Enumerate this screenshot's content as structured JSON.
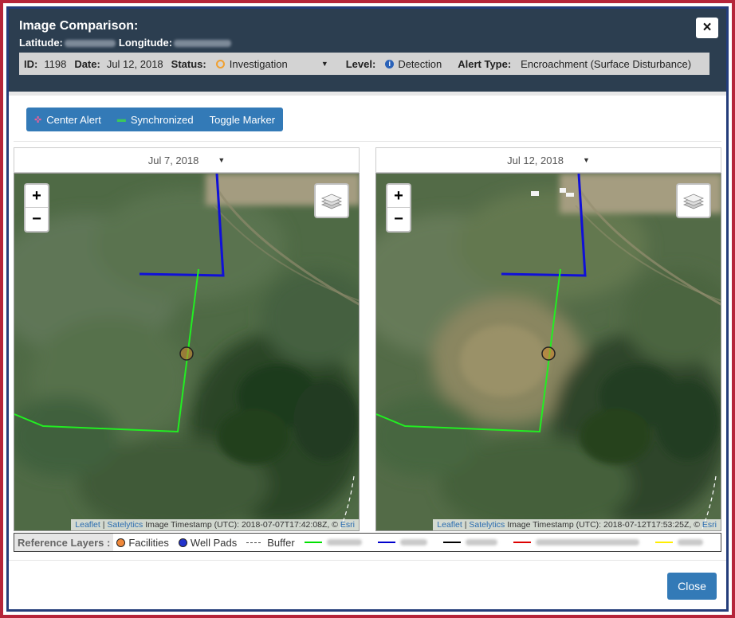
{
  "header": {
    "title": "Image Comparison:",
    "latitude_label": "Latitude:",
    "longitude_label": "Longitude:",
    "close_icon": "×"
  },
  "info": {
    "id_label": "ID:",
    "id_value": "1198",
    "date_label": "Date:",
    "date_value": "Jul 12, 2018",
    "status_label": "Status:",
    "status_value": "Investigation",
    "level_label": "Level:",
    "level_value": "Detection",
    "alert_type_label": "Alert Type:",
    "alert_type_value": "Encroachment (Surface Disturbance)"
  },
  "toolbar": {
    "center_alert": "Center Alert",
    "synchronized": "Synchronized",
    "toggle_marker": "Toggle Marker"
  },
  "maps": [
    {
      "date": "Jul 7, 2018",
      "zoom_in": "+",
      "zoom_out": "−",
      "attribution_leaflet": "Leaflet",
      "attribution_sep": " | ",
      "attribution_satelytics": "Satelytics",
      "attribution_text": " Image Timestamp (UTC): 2018-07-07T17:42:08Z, © ",
      "attribution_esri": "Esri"
    },
    {
      "date": "Jul 12, 2018",
      "zoom_in": "+",
      "zoom_out": "−",
      "attribution_leaflet": "Leaflet",
      "attribution_sep": " | ",
      "attribution_satelytics": "Satelytics",
      "attribution_text": " Image Timestamp (UTC): 2018-07-12T17:53:25Z, © ",
      "attribution_esri": "Esri"
    }
  ],
  "reference_layers": {
    "title": "Reference Layers :",
    "facilities": "Facilities",
    "well_pads": "Well Pads",
    "buffer": "Buffer"
  },
  "colors": {
    "facilities": "#f0883a",
    "well_pads": "#2233cc",
    "layer1": "#00e000",
    "layer2": "#0000cc",
    "layer3": "#000000",
    "layer4": "#dd0000",
    "layer5": "#ffee00"
  },
  "footer": {
    "close": "Close"
  }
}
